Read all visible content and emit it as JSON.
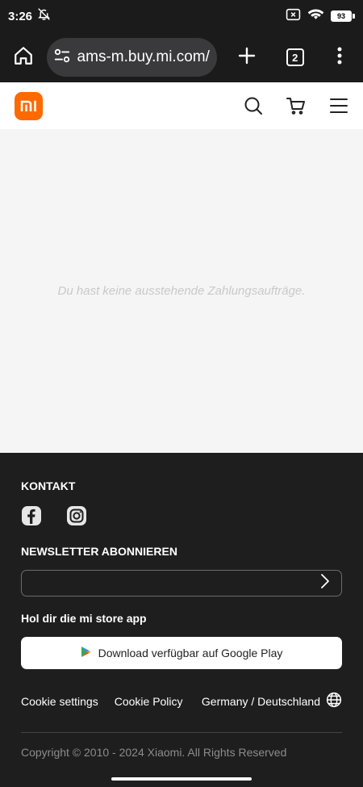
{
  "status": {
    "time": "3:26",
    "battery": "93",
    "icons": [
      "muted-bell-icon",
      "no-sim-icon",
      "wifi-icon",
      "battery-icon"
    ]
  },
  "browser": {
    "url": "ams-m.buy.mi.com/",
    "tab_count": "2",
    "icons": [
      "home-icon",
      "site-settings-icon",
      "new-tab-icon",
      "tabs-icon",
      "menu-icon"
    ]
  },
  "site_header": {
    "logo_text": "mi",
    "icons": [
      "search-icon",
      "cart-icon",
      "hamburger-menu-icon"
    ],
    "brand_color": "#ff6900"
  },
  "main": {
    "empty_message": "Du hast keine ausstehende Zahlungsaufträge."
  },
  "footer": {
    "contact_title": "KONTAKT",
    "social": [
      "facebook-icon",
      "instagram-icon"
    ],
    "newsletter_title": "NEWSLETTER ABONNIEREN",
    "newsletter_value": "",
    "app_title": "Hol dir die mi store app",
    "google_play_label": "Download verfügbar auf Google Play",
    "cookie_settings": "Cookie settings",
    "cookie_policy": "Cookie Policy",
    "region": "Germany / Deutschland",
    "copyright": "Copyright © 2010 - 2024 Xiaomi. All Rights Reserved"
  }
}
